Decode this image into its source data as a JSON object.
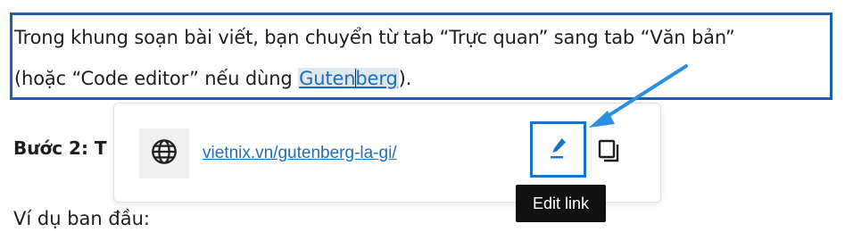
{
  "editor": {
    "paragraph": {
      "line1": "Trong khung soạn bài viết, bạn chuyển từ tab “Trực quan” sang tab “Văn bản”",
      "line2_before": "(hoặc “Code editor” nếu dùng ",
      "link_part1": "Guten",
      "link_part2": "berg",
      "line2_after": ")."
    },
    "step_heading": "Bước 2: T",
    "example_text": "Ví dụ ban đầu:"
  },
  "link_popover": {
    "url": "vietnix.vn/gutenberg-la-gi/",
    "globe_icon": "globe-icon",
    "edit_icon": "pencil-icon",
    "copy_icon": "copy-icon",
    "tooltip": "Edit link"
  },
  "colors": {
    "block_border": "#1a5fa8",
    "link": "#1f6fb2",
    "annotation_arrow": "#2a8fe0",
    "tooltip_bg": "#111111"
  }
}
